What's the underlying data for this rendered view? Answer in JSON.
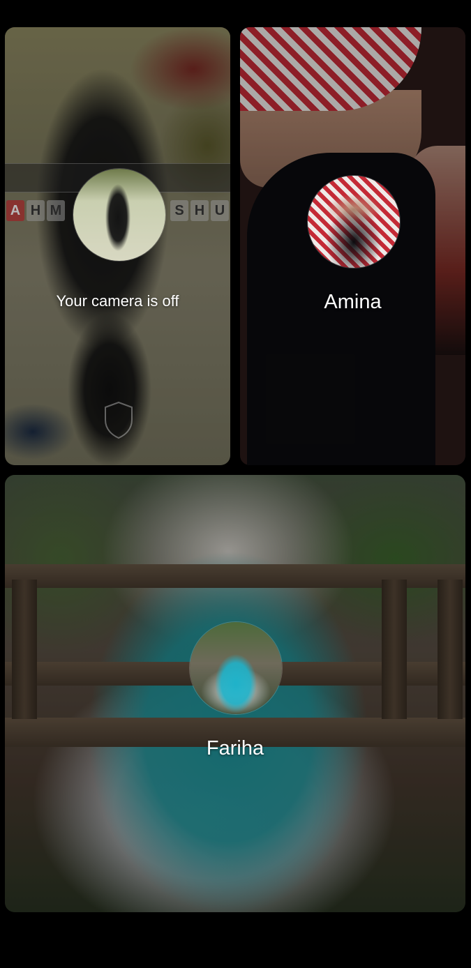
{
  "tiles": [
    {
      "id": "self",
      "label": "Your camera is off",
      "banner_left_letters": [
        "A",
        "H",
        "M"
      ],
      "banner_right_letters": [
        "S",
        "H",
        "U"
      ]
    },
    {
      "id": "amina",
      "label": "Amina"
    },
    {
      "id": "fariha",
      "label": "Fariha"
    }
  ],
  "colors": {
    "background": "#000000",
    "label_text": "#ffffff"
  },
  "icons": {
    "self_watermark": "shield-icon"
  }
}
